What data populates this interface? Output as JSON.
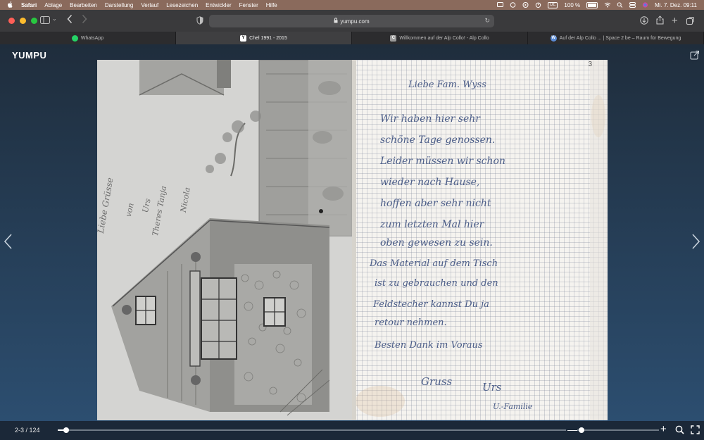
{
  "menubar": {
    "app_name": "Safari",
    "items": [
      "Ablage",
      "Bearbeiten",
      "Darstellung",
      "Verlauf",
      "Lesezeichen",
      "Entwickler",
      "Fenster",
      "Hilfe"
    ],
    "input_source": "DE",
    "battery": "100 %",
    "datetime": "Mi. 7. Dez.  09:11"
  },
  "toolbar": {
    "url": "yumpu.com"
  },
  "tabs": [
    {
      "label": "WhatsApp",
      "icon": "whatsapp-icon",
      "color": "#25d366",
      "active": false
    },
    {
      "label": "Chel 1991 - 2015",
      "icon": "yumpu-icon",
      "color": "#ffffff",
      "active": true
    },
    {
      "label": "Willkommen auf der Alp Collo! - Alp Collo",
      "icon": "alp-collo-icon",
      "color": "#9a9a9a",
      "active": false
    },
    {
      "label": "Auf der Alp Collo ... | Space 2 be – Raum für Bewegung",
      "icon": "wordpress-icon",
      "color": "#5b8bd4",
      "active": false
    }
  ],
  "viewer": {
    "logo": "YUMPU",
    "left_page": {
      "pencil_lines": [
        "Liebe Grüsse",
        "von",
        "Urs",
        "Theres  Tanja",
        "Nicola"
      ]
    },
    "right_page": {
      "page_number": "3",
      "lines": [
        "Liebe Fam. Wyss",
        "Wir haben hier sehr",
        "schöne Tage genossen.",
        "Leider müssen wir schon",
        "wieder nach Hause,",
        "hoffen aber sehr nicht",
        "zum letzten Mal hier",
        "oben gewesen zu sein.",
        "Das Material auf dem Tisch",
        "ist zu gebrauchen und den",
        "Feldstecher kannst Du ja",
        "retour nehmen.",
        "Besten Dank im Voraus",
        "Gruss",
        "Urs",
        "U.-Familie"
      ]
    }
  },
  "bottombar": {
    "page_indicator": "2-3 / 124",
    "progress": 0.0161,
    "zoom_level": 0.05
  },
  "colors": {
    "menubar": "#8a6a5c",
    "toolbar": "#3a3a3c",
    "viewer_top": "#1f2d3c",
    "viewer_bottom": "#2c4e70",
    "ink": "#4b5d88"
  }
}
